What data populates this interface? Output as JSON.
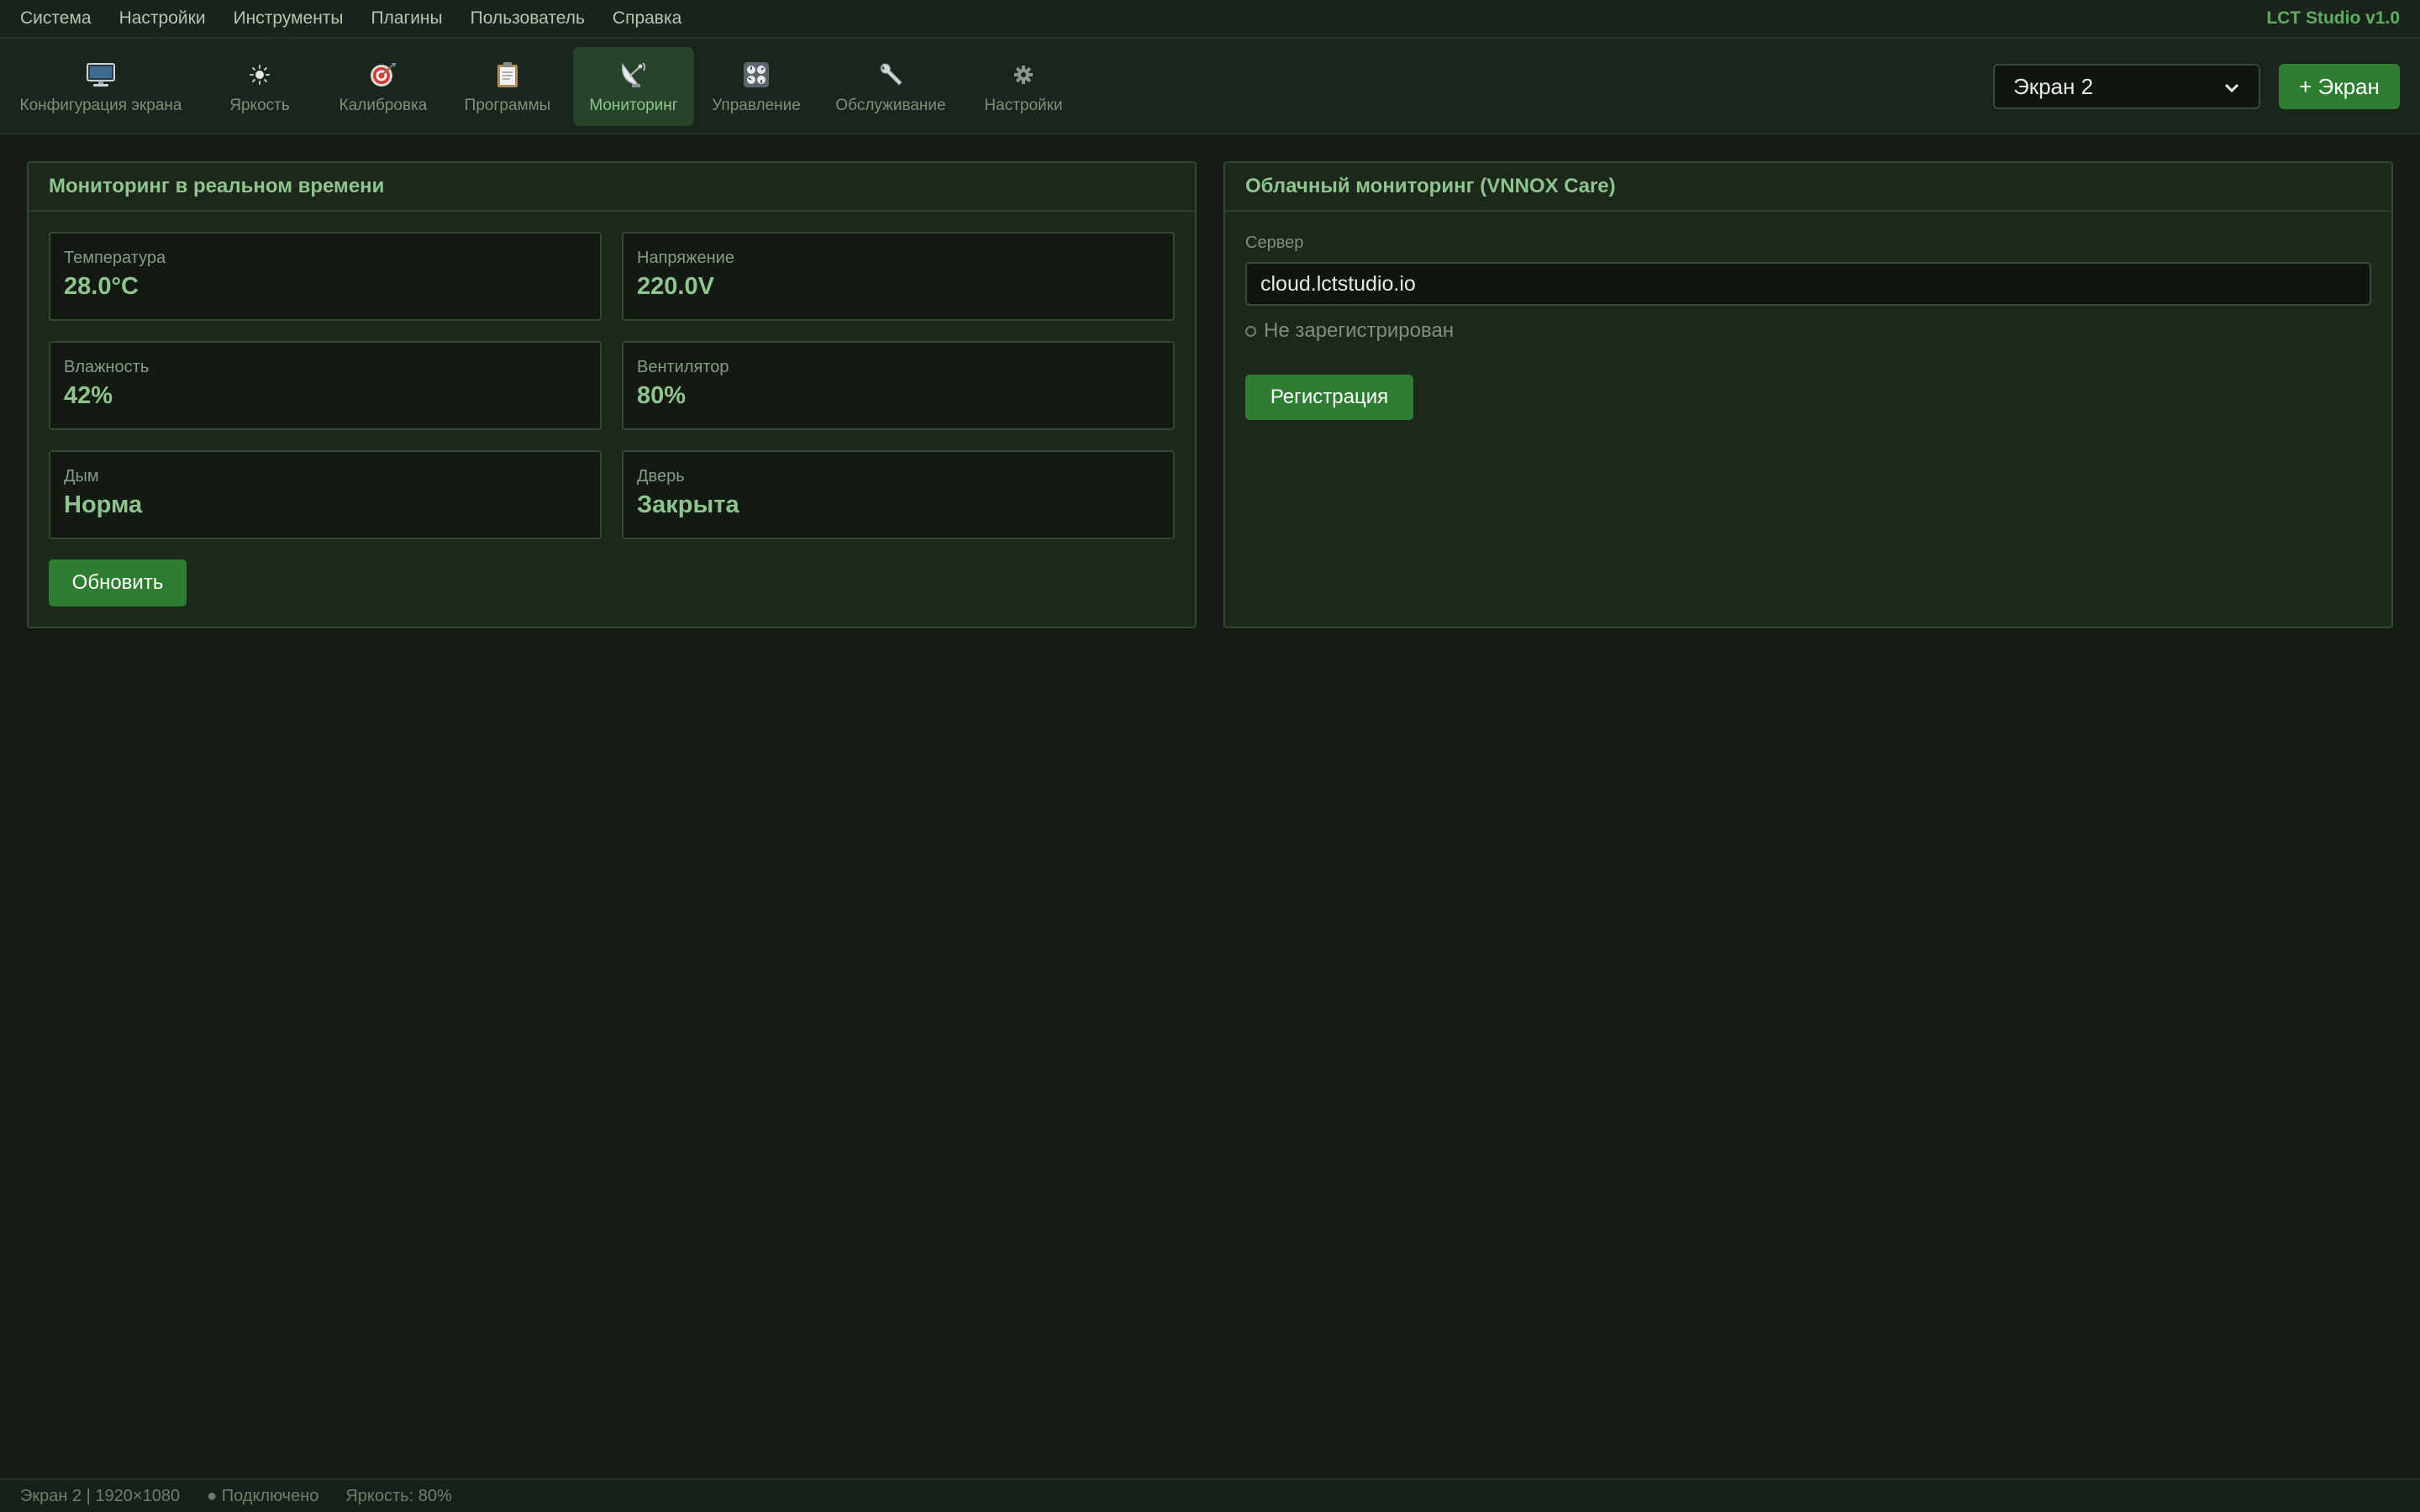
{
  "menu": {
    "items": [
      "Система",
      "Настройки",
      "Инструменты",
      "Плагины",
      "Пользователь",
      "Справка"
    ],
    "app_title": "LCT Studio v1.0"
  },
  "toolbar": {
    "tools": [
      {
        "label": "Конфигурация экрана",
        "icon": "monitor-icon"
      },
      {
        "label": "Яркость",
        "icon": "sun-icon"
      },
      {
        "label": "Калибровка",
        "icon": "target-icon"
      },
      {
        "label": "Программы",
        "icon": "clipboard-icon"
      },
      {
        "label": "Мониторинг",
        "icon": "satellite-dish-icon",
        "active": true
      },
      {
        "label": "Управление",
        "icon": "control-knobs-icon"
      },
      {
        "label": "Обслуживание",
        "icon": "wrench-icon"
      },
      {
        "label": "Настройки",
        "icon": "gear-icon"
      }
    ],
    "screen_select_value": "Экран 2",
    "add_screen_label": "+ Экран"
  },
  "realtime": {
    "title": "Мониторинг в реальном времени",
    "cards": [
      {
        "label": "Температура",
        "value": "28.0°C"
      },
      {
        "label": "Напряжение",
        "value": "220.0V"
      },
      {
        "label": "Влажность",
        "value": "42%"
      },
      {
        "label": "Вентилятор",
        "value": "80%"
      },
      {
        "label": "Дым",
        "value": "Норма"
      },
      {
        "label": "Дверь",
        "value": "Закрыта"
      }
    ],
    "refresh_label": "Обновить"
  },
  "cloud": {
    "title": "Облачный мониторинг (VNNOX Care)",
    "server_label": "Сервер",
    "server_value": "cloud.lctstudio.io",
    "status": "Не зарегистрирован",
    "register_label": "Регистрация"
  },
  "statusbar": {
    "screen": "Экран 2 | 1920×1080",
    "connection": "● Подключено",
    "brightness": "Яркость: 80%"
  },
  "colors": {
    "accent": "#2e7d32",
    "accent_text": "#8fc48f",
    "background": "#131b13"
  }
}
